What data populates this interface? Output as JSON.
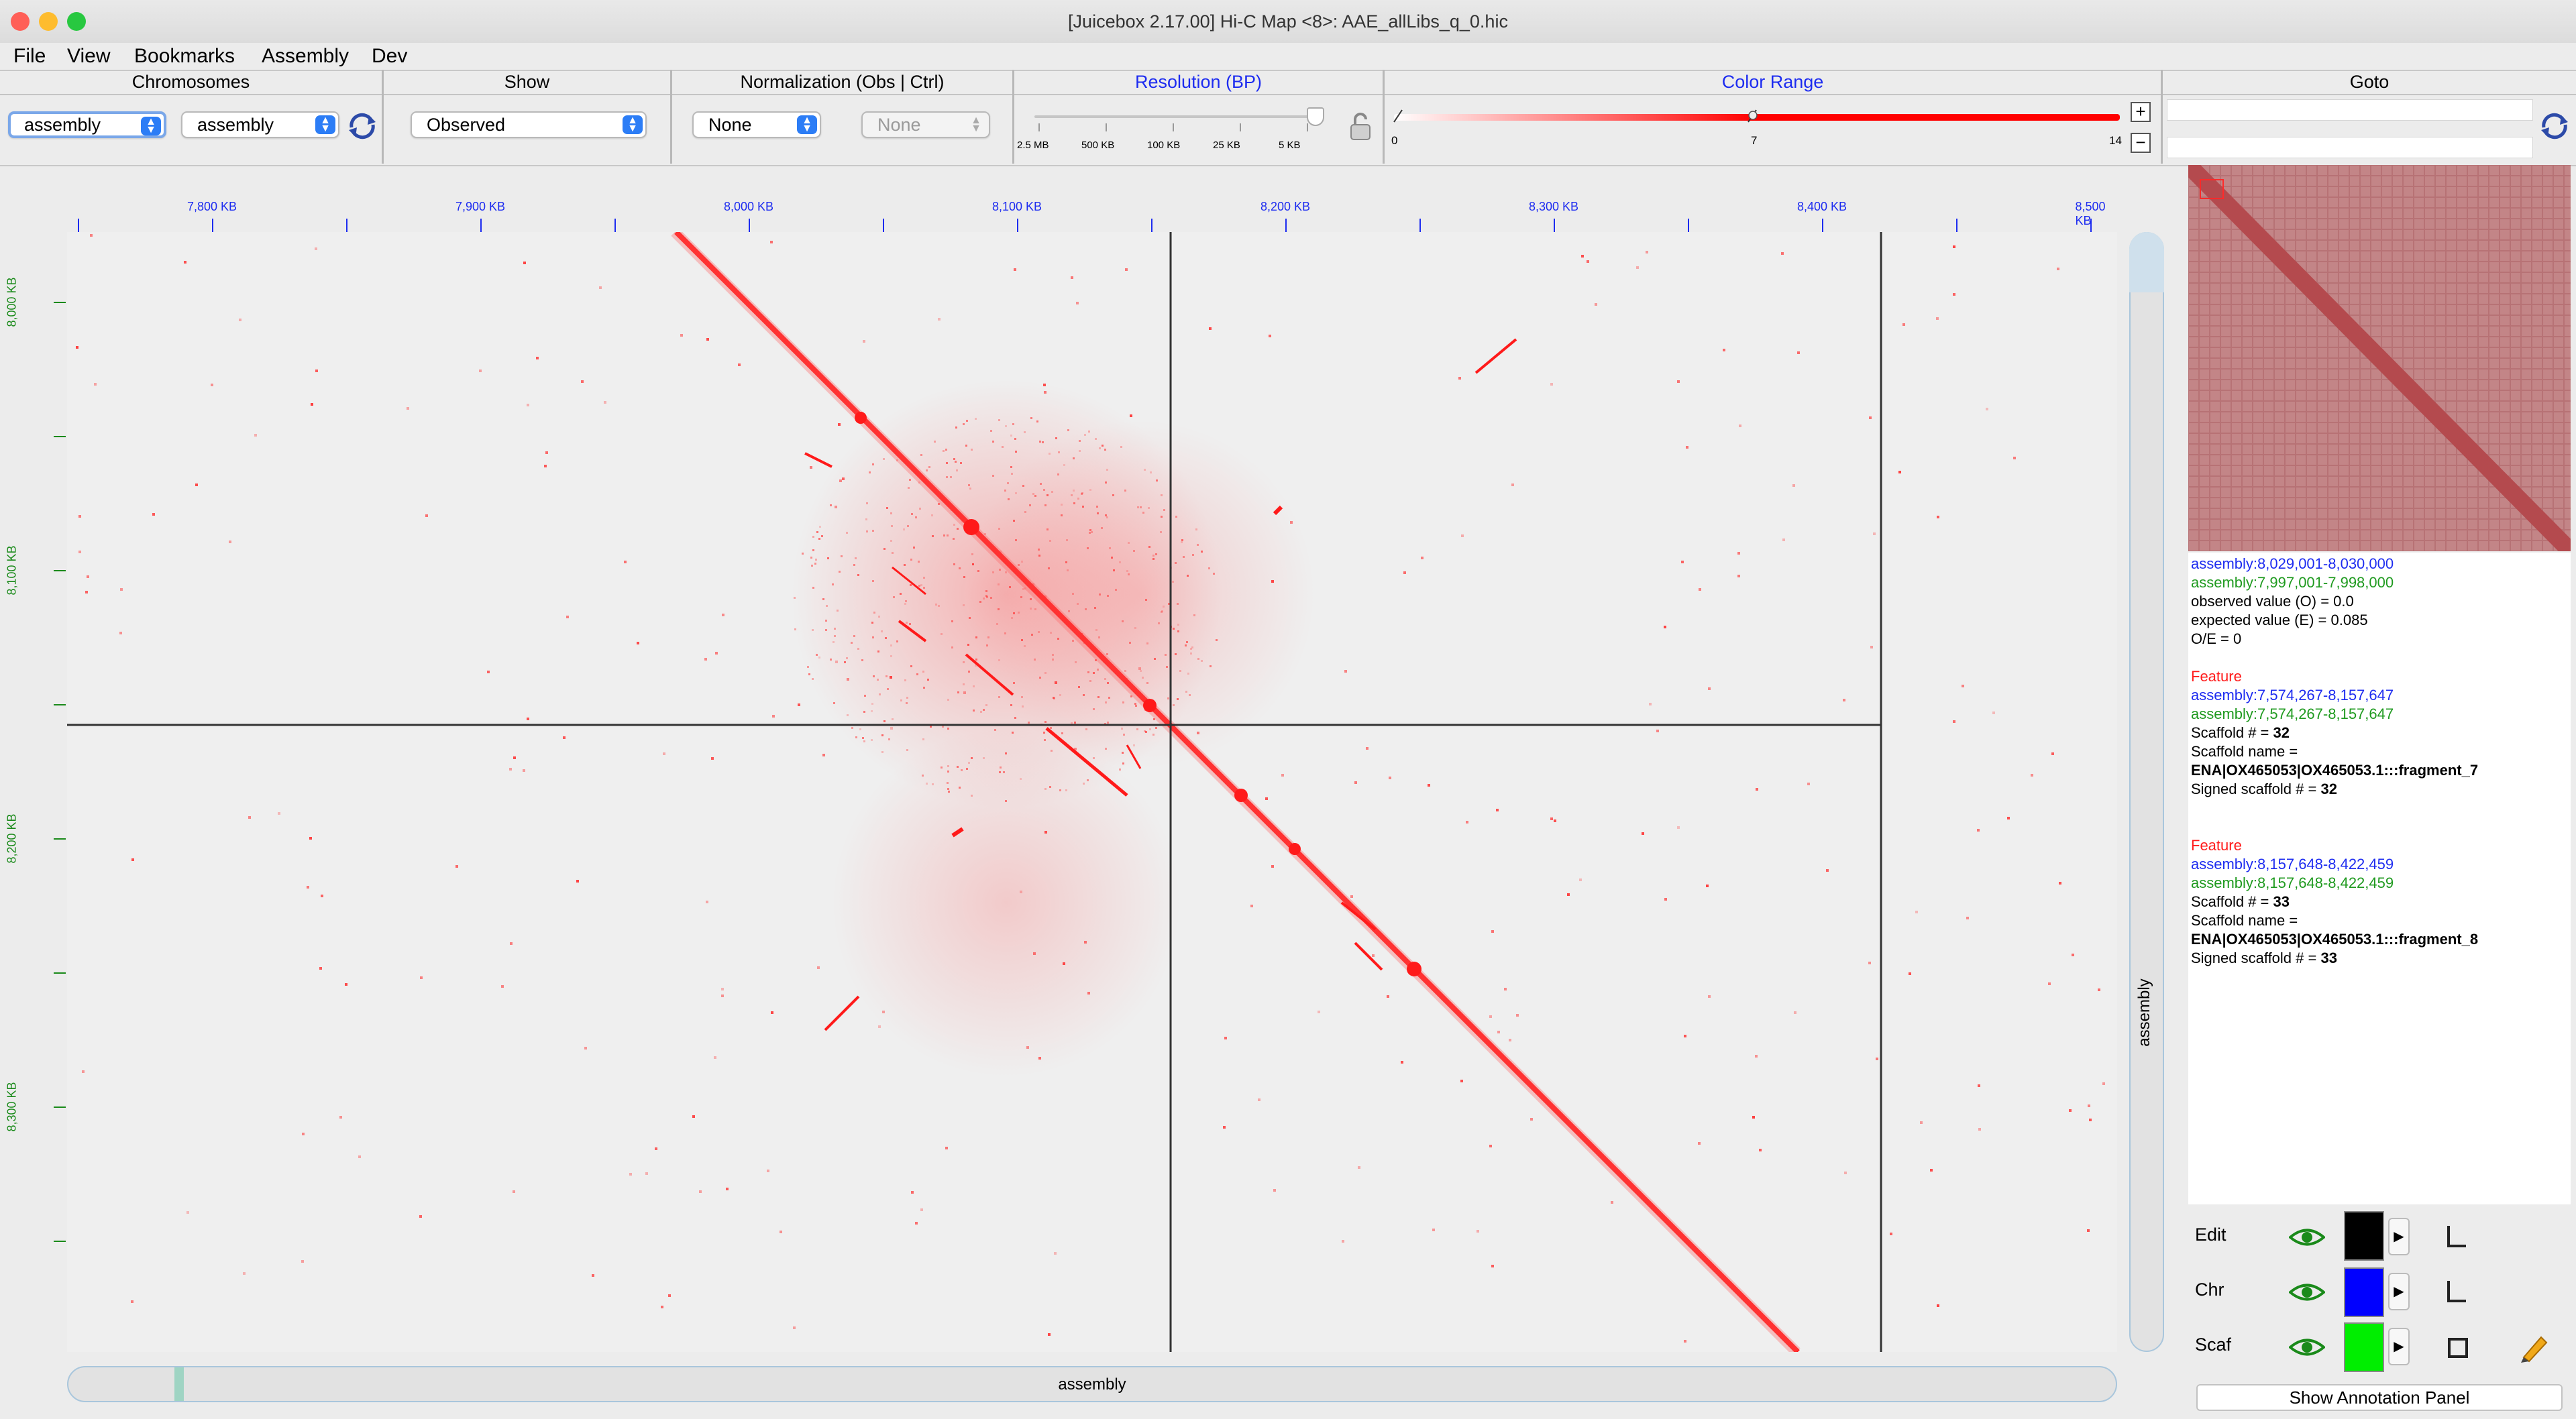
{
  "window": {
    "title": "[Juicebox 2.17.00] Hi-C Map <8>: AAE_allLibs_q_0.hic",
    "traffic_light_colors": [
      "#ff5f57",
      "#febc2e",
      "#28c840"
    ]
  },
  "menu": [
    "File",
    "View",
    "Bookmarks",
    "Assembly",
    "Dev"
  ],
  "toolbar": {
    "chromosomes": {
      "title": "Chromosomes",
      "x_value": "assembly",
      "y_value": "assembly",
      "refresh_icon": "refresh-icon"
    },
    "show": {
      "title": "Show",
      "value": "Observed"
    },
    "normalization": {
      "title": "Normalization  (Obs  |  Ctrl)",
      "obs_value": "None",
      "ctrl_value": "None"
    },
    "resolution": {
      "title": "Resolution (BP)",
      "labels": [
        "2.5 MB",
        "500 KB",
        "100 KB",
        "25 KB",
        "5 KB"
      ],
      "selected_index": 4,
      "lock_icon": "lock-icon"
    },
    "color_range": {
      "title": "Color Range",
      "min_label": "0",
      "mid_label": "7",
      "max_label": "14",
      "low_thumb": 0,
      "high_thumb": 7,
      "max": 14,
      "color": "#ff0000"
    },
    "goto": {
      "title": "Goto",
      "x_value": "",
      "y_value": "",
      "refresh_icon": "refresh-icon"
    }
  },
  "map": {
    "x_axis_labels": [
      "7,800 KB",
      "7,900 KB",
      "8,000 KB",
      "8,100 KB",
      "8,200 KB",
      "8,300 KB",
      "8,400 KB",
      "8,500 KB"
    ],
    "y_axis_labels": [
      "8,000 KB",
      "8,100 KB",
      "8,200 KB",
      "8,300 KB"
    ],
    "axis_label_x_color": "#1d2cf0",
    "axis_label_y_color": "#1a8a1a",
    "signal_color": "#ff0000",
    "vertical_scroll_label": "assembly",
    "horizontal_scroll_label": "assembly"
  },
  "info": {
    "lines": [
      {
        "text": "assembly:8,029,001-8,030,000",
        "color": "blue"
      },
      {
        "text": "assembly:7,997,001-7,998,000",
        "color": "green"
      },
      {
        "text": "observed value (O) = 0.0",
        "color": "black"
      },
      {
        "text": "expected value (E) = 0.085",
        "color": "black"
      },
      {
        "text": "O/E = 0",
        "color": "black"
      }
    ],
    "features": [
      {
        "heading": "Feature",
        "x_range": "assembly:7,574,267-8,157,647",
        "y_range": "assembly:7,574,267-8,157,647",
        "scaffold_label": "Scaffold # = ",
        "scaffold_num": "32",
        "name_label": "Scaffold name =",
        "name_value": "ENA|OX465053|OX465053.1:::fragment_7",
        "signed_label": "Signed scaffold # = ",
        "signed_num": "32"
      },
      {
        "heading": "Feature",
        "x_range": "assembly:8,157,648-8,422,459",
        "y_range": "assembly:8,157,648-8,422,459",
        "scaffold_label": "Scaffold # = ",
        "scaffold_num": "33",
        "name_label": "Scaffold name =",
        "name_value": "ENA|OX465053|OX465053.1:::fragment_8",
        "signed_label": "Signed scaffold # = ",
        "signed_num": "33"
      }
    ]
  },
  "layers": [
    {
      "label": "Edit",
      "color": "#000000",
      "icon": "corner-icon"
    },
    {
      "label": "Chr",
      "color": "#0000ff",
      "icon": "corner-icon"
    },
    {
      "label": "Scaf",
      "color": "#00ee00",
      "icon": "square-icon",
      "edit_icon": "pencil-icon"
    }
  ],
  "show_annotation_panel": "Show Annotation Panel"
}
